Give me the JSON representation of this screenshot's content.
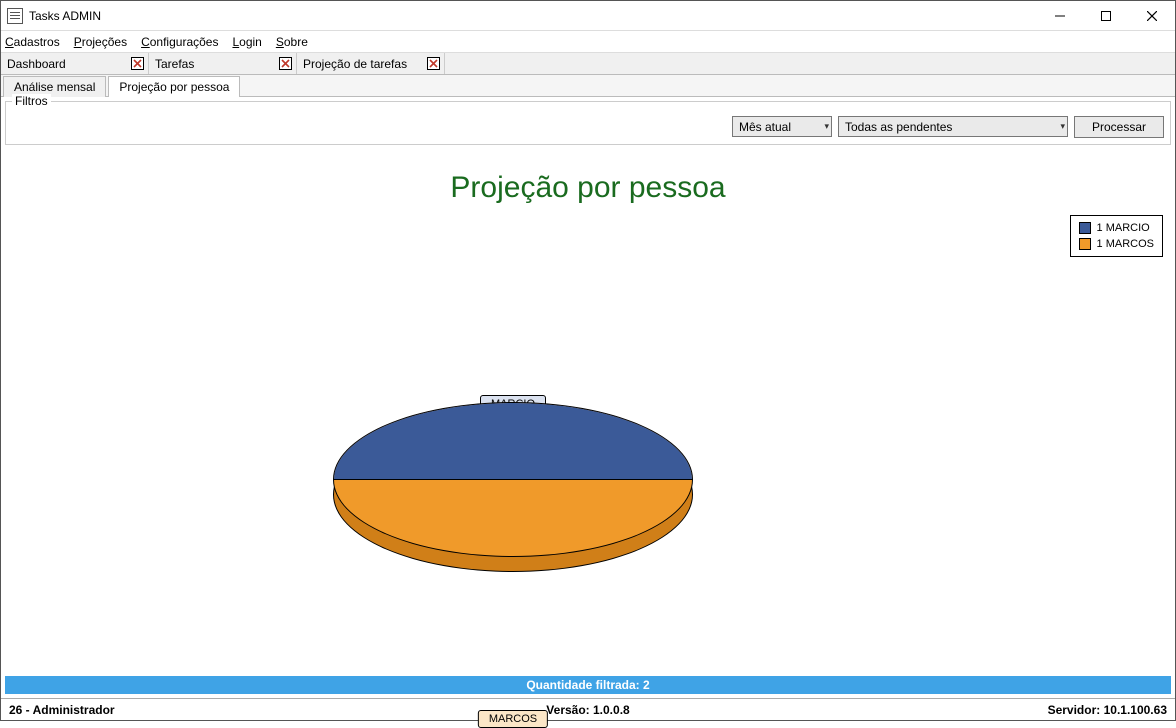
{
  "window": {
    "title": "Tasks ADMIN"
  },
  "menu": {
    "items": [
      {
        "prefix": "C",
        "rest": "adastros"
      },
      {
        "prefix": "P",
        "rest": "rojeções"
      },
      {
        "prefix": "C",
        "rest": "onfigurações"
      },
      {
        "prefix": "L",
        "rest": "ogin"
      },
      {
        "prefix": "S",
        "rest": "obre"
      }
    ]
  },
  "mdi_tabs": [
    {
      "label": "Dashboard"
    },
    {
      "label": "Tarefas"
    },
    {
      "label": "Projeção de tarefas"
    }
  ],
  "sub_tabs": [
    {
      "label": "Análise mensal",
      "active": false
    },
    {
      "label": "Projeção por pessoa",
      "active": true
    }
  ],
  "filters": {
    "group_label": "Filtros",
    "month_selected": "Mês atual",
    "status_selected": "Todas as pendentes",
    "process_label": "Processar"
  },
  "chart_data": {
    "type": "pie",
    "title": "Projeção por pessoa",
    "series": [
      {
        "name": "MARCIO",
        "value": 1,
        "color": "#3b5a98",
        "legend": "1 MARCIO"
      },
      {
        "name": "MARCOS",
        "value": 1,
        "color": "#f09a2a",
        "legend": "1 MARCOS"
      }
    ]
  },
  "summary": {
    "text": "Quantidade filtrada: 2"
  },
  "status": {
    "user": "26 - Administrador",
    "version_label": "Versão:",
    "version_value": "1.0.0.8",
    "server_label": "Servidor:",
    "server_value": "10.1.100.63"
  }
}
